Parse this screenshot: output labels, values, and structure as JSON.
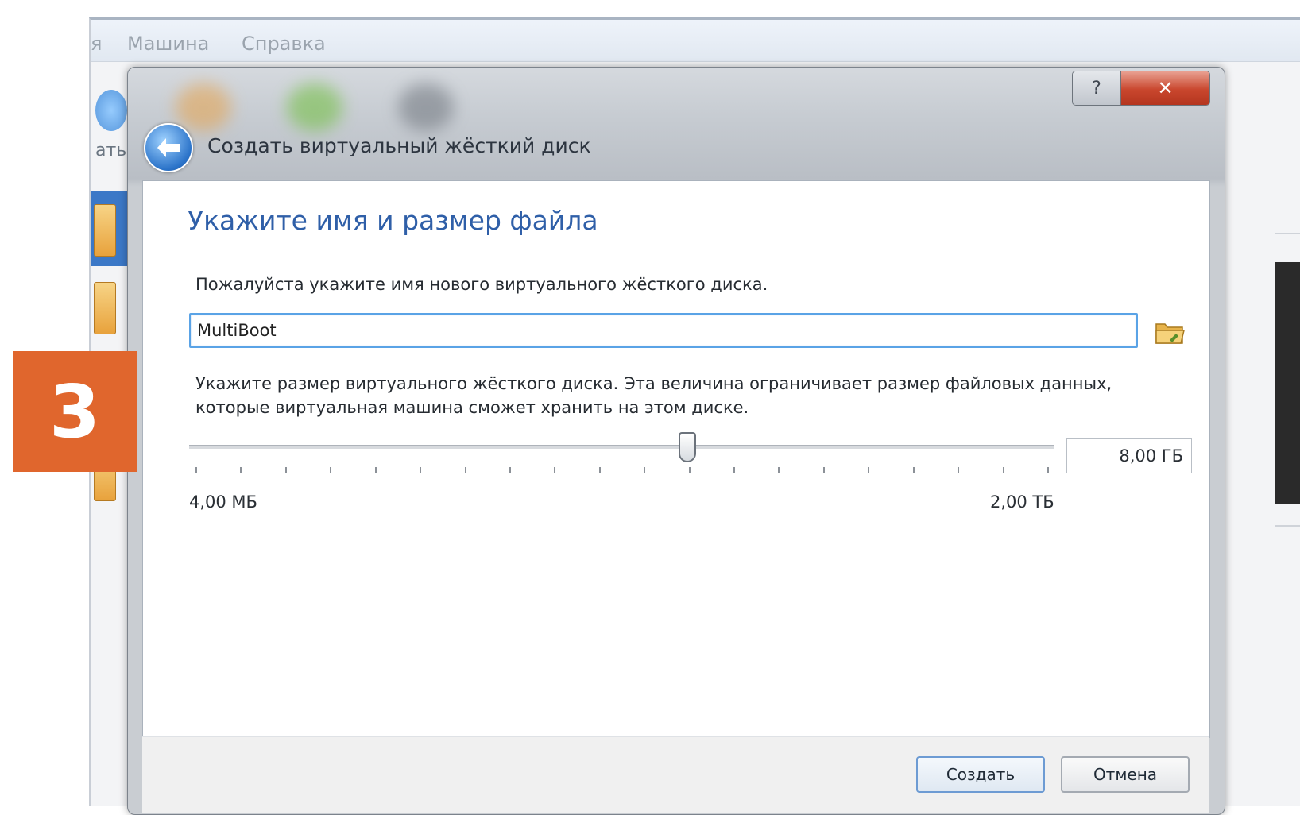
{
  "background_window": {
    "menu": [
      "Машина",
      "Справка"
    ],
    "menu_partial": "я",
    "toolbar_label_partial": "ать"
  },
  "dialog": {
    "title": "Создать виртуальный жёсткий диск",
    "help_label": "?",
    "close_label": "✕",
    "heading": "Укажите имя и размер файла",
    "name_instruction": "Пожалуйста укажите имя нового виртуального жёсткого диска.",
    "name_value": "MultiBoot",
    "size_instruction": "Укажите размер виртуального жёсткого диска. Эта величина ограничивает размер файловых данных, которые виртуальная машина сможет хранить на этом диске.",
    "size_value": "8,00 ГБ",
    "slider": {
      "min_label": "4,00 МБ",
      "max_label": "2,00 ТБ",
      "position": 0.576,
      "ticks": 20
    },
    "buttons": {
      "create": "Создать",
      "cancel": "Отмена"
    }
  },
  "step_badge": "3",
  "colors": {
    "accent": "#2f5fa8",
    "badge": "#e0662d",
    "close": "#c9462d"
  },
  "icons": [
    "back-arrow-icon",
    "folder-icon",
    "help-icon",
    "close-icon"
  ]
}
